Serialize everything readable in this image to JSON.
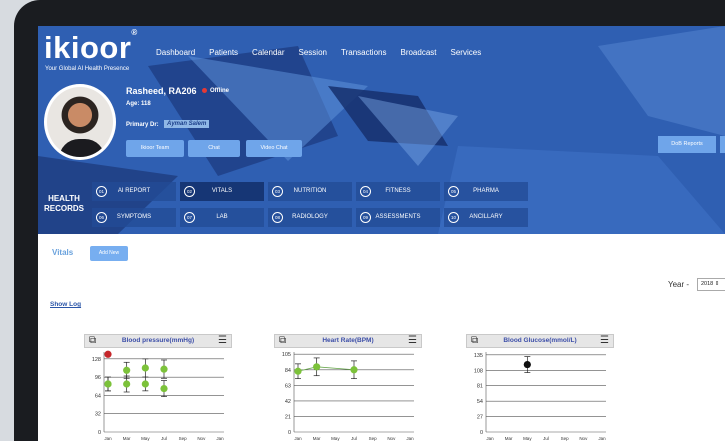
{
  "app": {
    "logo": "ikioor",
    "logo_mark": "®",
    "tagline": "Your Global AI Health Presence"
  },
  "nav": [
    "Dashboard",
    "Patients",
    "Calendar",
    "Session",
    "Transactions",
    "Broadcast",
    "Services"
  ],
  "patient": {
    "name": "Rasheed, RA206",
    "status": "Offline",
    "age": "Age: 118",
    "primary_label": "Primary Dr:",
    "primary_doctor": "Ayman Salem",
    "buttons": [
      "Ikioor Team",
      "Chat",
      "Video Chat"
    ],
    "right_button": "DoB Reports"
  },
  "health_records": {
    "label_line1": "HEALTH",
    "label_line2": "RECORDS",
    "items": [
      {
        "num": "01",
        "label": "AI REPORT"
      },
      {
        "num": "02",
        "label": "VITALS"
      },
      {
        "num": "03",
        "label": "NUTRITION"
      },
      {
        "num": "04",
        "label": "FITNESS"
      },
      {
        "num": "05",
        "label": "PHARMA"
      },
      {
        "num": "06",
        "label": "SYMPTOMS"
      },
      {
        "num": "07",
        "label": "LAB"
      },
      {
        "num": "08",
        "label": "RADIOLOGY"
      },
      {
        "num": "09",
        "label": "ASSESSMENTS"
      },
      {
        "num": "10",
        "label": "ANCILLARY"
      }
    ]
  },
  "vitals": {
    "title": "Vitals",
    "add_new": "Add New",
    "show_log": "Show Log",
    "year_label": "Year -",
    "year_value": "2018 ⇕"
  },
  "colors": {
    "header_blue": "#2f5fb2",
    "accent_button": "#6fa5ea",
    "green_point": "#7cc23a",
    "red_point": "#c6272b"
  },
  "chart_data": [
    {
      "type": "scatter",
      "title": "Blood pressure(mmHg)",
      "categories": [
        "Jan",
        "Mar",
        "May",
        "Jul",
        "Sep",
        "Nov",
        "Jan"
      ],
      "yticks": [
        0,
        32,
        64,
        96,
        128
      ],
      "ylim": [
        0,
        140
      ],
      "series": [
        {
          "color": "#7cc23a",
          "points": [
            [
              0,
              84
            ],
            [
              1,
              108
            ],
            [
              2,
              112
            ],
            [
              3,
              110
            ]
          ],
          "errors": [
            12,
            14,
            16,
            16
          ]
        },
        {
          "color": "#7cc23a",
          "points": [
            [
              0,
              84
            ],
            [
              1,
              84
            ],
            [
              2,
              84
            ],
            [
              3,
              76
            ]
          ],
          "errors": [
            12,
            14,
            12,
            14
          ]
        },
        {
          "color": "#c6272b",
          "points": [
            [
              0,
              136
            ]
          ],
          "errors": [
            0
          ]
        }
      ]
    },
    {
      "type": "line",
      "title": "Heart Rate(BPM)",
      "categories": [
        "Jan",
        "Mar",
        "May",
        "Jul",
        "Sep",
        "Nov",
        "Jan"
      ],
      "yticks": [
        0,
        21,
        42,
        63,
        84,
        105
      ],
      "ylim": [
        0,
        108
      ],
      "series": [
        {
          "color": "#7cc23a",
          "points": [
            [
              0,
              82
            ],
            [
              1,
              88
            ],
            [
              3,
              84
            ]
          ],
          "errors": [
            10,
            12,
            12
          ]
        }
      ]
    },
    {
      "type": "scatter",
      "title": "Blood Glucose(mmol/L)",
      "categories": [
        "Jan",
        "Mar",
        "May",
        "Jul",
        "Sep",
        "Nov",
        "Jan"
      ],
      "yticks": [
        0,
        27,
        54,
        81,
        108,
        135
      ],
      "ylim": [
        0,
        140
      ],
      "series": [
        {
          "color": "#111111",
          "points": [
            [
              2,
              118
            ]
          ],
          "errors": [
            14
          ]
        }
      ]
    }
  ]
}
